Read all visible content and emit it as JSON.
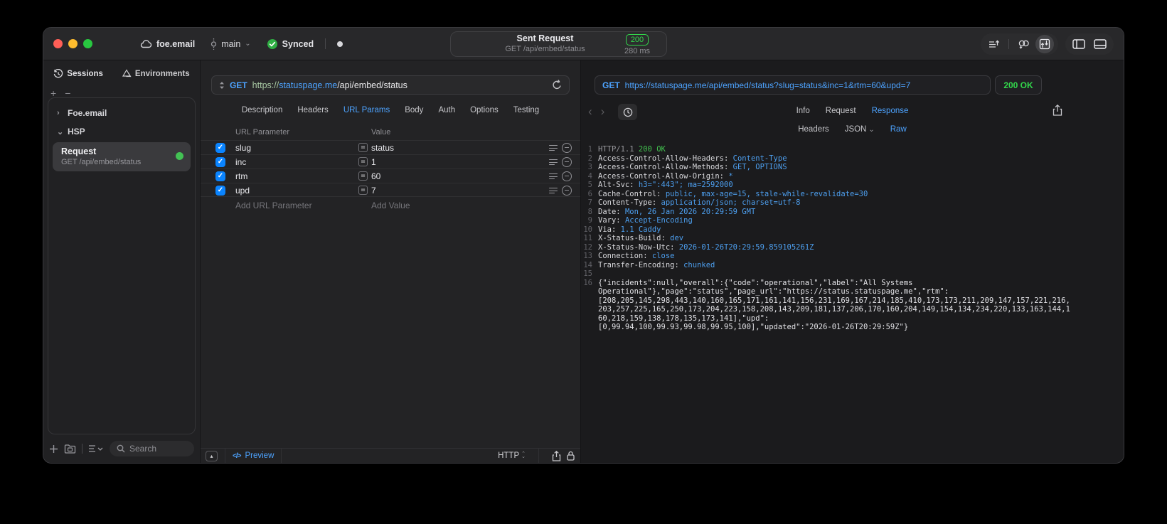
{
  "titlebar": {
    "project_name": "foe.email",
    "branch_name": "main",
    "sync_label": "Synced",
    "request_summary": {
      "title": "Sent Request",
      "subtitle": "GET /api/embed/status",
      "status_code": "200",
      "duration": "280 ms"
    }
  },
  "sidebar": {
    "tabs": [
      {
        "label": "Sessions"
      },
      {
        "label": "Environments"
      }
    ],
    "groups": [
      {
        "label": "Foe.email",
        "expanded": false
      },
      {
        "label": "HSP",
        "expanded": true
      }
    ],
    "request_item": {
      "title": "Request",
      "subtitle": "GET /api/embed/status"
    },
    "search_placeholder": "Search"
  },
  "request_editor": {
    "method": "GET",
    "url": {
      "scheme": "https://",
      "host": "statuspage.me",
      "path": "/api/embed/status"
    },
    "tabs": [
      "Description",
      "Headers",
      "URL Params",
      "Body",
      "Auth",
      "Options",
      "Testing"
    ],
    "active_tab": "URL Params",
    "params": {
      "columns": [
        "URL Parameter",
        "Value"
      ],
      "rows": [
        {
          "enabled": true,
          "name": "slug",
          "value": "status"
        },
        {
          "enabled": true,
          "name": "inc",
          "value": "1"
        },
        {
          "enabled": true,
          "name": "rtm",
          "value": "60"
        },
        {
          "enabled": true,
          "name": "upd",
          "value": "7"
        }
      ],
      "add_name_placeholder": "Add URL Parameter",
      "add_value_placeholder": "Add Value"
    },
    "footer": {
      "preview_label": "Preview",
      "protocol": "HTTP"
    }
  },
  "response_viewer": {
    "method": "GET",
    "url": "https://statuspage.me/api/embed/status?slug=status&inc=1&rtm=60&upd=7",
    "status_badge": "200 OK",
    "tabs": [
      "Info",
      "Request",
      "Response"
    ],
    "active_tab": "Response",
    "view_tabs": [
      "Headers",
      "JSON",
      "Raw"
    ],
    "active_view_tab": "Raw",
    "raw": {
      "status_line": {
        "protocol": "HTTP/1.1",
        "status": "200 OK"
      },
      "headers": [
        {
          "name": "Access-Control-Allow-Headers",
          "value": "Content-Type"
        },
        {
          "name": "Access-Control-Allow-Methods",
          "value": "GET, OPTIONS"
        },
        {
          "name": "Access-Control-Allow-Origin",
          "value": "*"
        },
        {
          "name": "Alt-Svc",
          "value": "h3=\":443\"; ma=2592000"
        },
        {
          "name": "Cache-Control",
          "value": "public, max-age=15, stale-while-revalidate=30"
        },
        {
          "name": "Content-Type",
          "value": "application/json; charset=utf-8"
        },
        {
          "name": "Date",
          "value": "Mon, 26 Jan 2026 20:29:59 GMT"
        },
        {
          "name": "Vary",
          "value": "Accept-Encoding"
        },
        {
          "name": "Via",
          "value": "1.1 Caddy"
        },
        {
          "name": "X-Status-Build",
          "value": "dev"
        },
        {
          "name": "X-Status-Now-Utc",
          "value": "2026-01-26T20:29:59.859105261Z"
        },
        {
          "name": "Connection",
          "value": "close"
        },
        {
          "name": "Transfer-Encoding",
          "value": "chunked"
        }
      ],
      "blank_line_number": 15,
      "body_line_number": 16,
      "body_display_lines": [
        "{\"incidents\":null,\"overall\":{\"code\":\"operational\",\"label\":\"All Systems",
        "Operational\"},\"page\":\"status\",\"page_url\":\"https://status.statuspage.me\",\"rtm\":",
        "[208,205,145,298,443,140,160,165,171,161,141,156,231,169,167,214,185,410,173,173,211,209,147,157,221,216,",
        "203,257,225,165,250,173,204,223,158,208,143,209,181,137,206,170,160,204,149,154,134,234,220,133,163,144,1",
        "60,218,159,138,178,135,173,141],\"upd\":",
        "[0,99.94,100,99.93,99.98,99.95,100],\"updated\":\"2026-01-26T20:29:59Z\"}"
      ],
      "body_raw": "{\"incidents\":null,\"overall\":{\"code\":\"operational\",\"label\":\"All Systems Operational\"},\"page\":\"status\",\"page_url\":\"https://status.statuspage.me\",\"rtm\":[208,205,145,298,443,140,160,165,171,161,141,156,231,169,167,214,185,410,173,173,211,209,147,157,221,216,203,257,225,165,250,173,204,223,158,208,143,209,181,137,206,170,160,204,149,154,134,234,220,133,163,144,160,218,159,138,178,135,173,141],\"upd\":[0,99.94,100,99.93,99.98,99.95,100],\"updated\":\"2026-01-26T20:29:59Z\"}"
    }
  },
  "colors": {
    "accent_blue": "#4da3ff",
    "success_green": "#32d74b",
    "checkbox_blue": "#0a84ff",
    "traffic_close": "#ff5f57",
    "traffic_minimize": "#febc2e",
    "traffic_zoom": "#28c840",
    "window_bg": "#1e1e20",
    "response_value_blue": "#4d9fef"
  },
  "glyphs": {
    "check": "✓",
    "equals": "=",
    "plus": "+",
    "minus": "−",
    "chevron_right": "›",
    "chevron_down": "⌄",
    "chevron_up": "⌃",
    "back": "‹",
    "forward": "›",
    "collapse_triangle": "▴",
    "code_icon": "</>"
  }
}
